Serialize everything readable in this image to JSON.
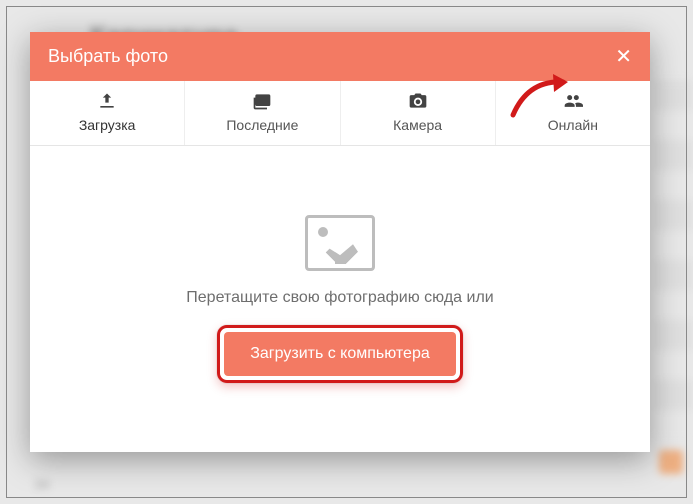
{
  "background": {
    "title": "Карикатура",
    "counter": "34"
  },
  "modal": {
    "title": "Выбрать фото",
    "tabs": [
      {
        "label": "Загрузка"
      },
      {
        "label": "Последние"
      },
      {
        "label": "Камера"
      },
      {
        "label": "Онлайн"
      }
    ],
    "drop_text": "Перетащите свою фотографию сюда или",
    "upload_button": "Загрузить с компьютера"
  }
}
